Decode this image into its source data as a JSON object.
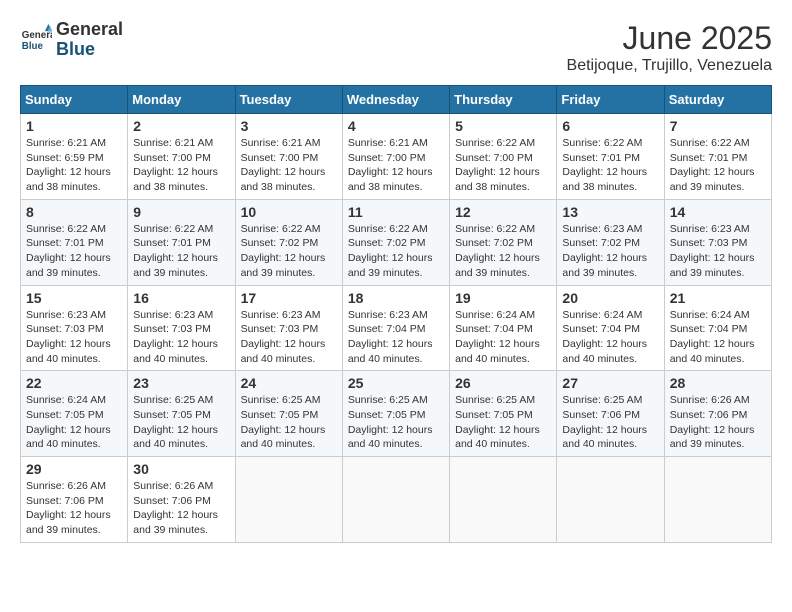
{
  "header": {
    "logo_general": "General",
    "logo_blue": "Blue",
    "title": "June 2025",
    "subtitle": "Betijoque, Trujillo, Venezuela"
  },
  "weekdays": [
    "Sunday",
    "Monday",
    "Tuesday",
    "Wednesday",
    "Thursday",
    "Friday",
    "Saturday"
  ],
  "weeks": [
    [
      {
        "day": "1",
        "info": "Sunrise: 6:21 AM\nSunset: 6:59 PM\nDaylight: 12 hours\nand 38 minutes."
      },
      {
        "day": "2",
        "info": "Sunrise: 6:21 AM\nSunset: 7:00 PM\nDaylight: 12 hours\nand 38 minutes."
      },
      {
        "day": "3",
        "info": "Sunrise: 6:21 AM\nSunset: 7:00 PM\nDaylight: 12 hours\nand 38 minutes."
      },
      {
        "day": "4",
        "info": "Sunrise: 6:21 AM\nSunset: 7:00 PM\nDaylight: 12 hours\nand 38 minutes."
      },
      {
        "day": "5",
        "info": "Sunrise: 6:22 AM\nSunset: 7:00 PM\nDaylight: 12 hours\nand 38 minutes."
      },
      {
        "day": "6",
        "info": "Sunrise: 6:22 AM\nSunset: 7:01 PM\nDaylight: 12 hours\nand 38 minutes."
      },
      {
        "day": "7",
        "info": "Sunrise: 6:22 AM\nSunset: 7:01 PM\nDaylight: 12 hours\nand 39 minutes."
      }
    ],
    [
      {
        "day": "8",
        "info": "Sunrise: 6:22 AM\nSunset: 7:01 PM\nDaylight: 12 hours\nand 39 minutes."
      },
      {
        "day": "9",
        "info": "Sunrise: 6:22 AM\nSunset: 7:01 PM\nDaylight: 12 hours\nand 39 minutes."
      },
      {
        "day": "10",
        "info": "Sunrise: 6:22 AM\nSunset: 7:02 PM\nDaylight: 12 hours\nand 39 minutes."
      },
      {
        "day": "11",
        "info": "Sunrise: 6:22 AM\nSunset: 7:02 PM\nDaylight: 12 hours\nand 39 minutes."
      },
      {
        "day": "12",
        "info": "Sunrise: 6:22 AM\nSunset: 7:02 PM\nDaylight: 12 hours\nand 39 minutes."
      },
      {
        "day": "13",
        "info": "Sunrise: 6:23 AM\nSunset: 7:02 PM\nDaylight: 12 hours\nand 39 minutes."
      },
      {
        "day": "14",
        "info": "Sunrise: 6:23 AM\nSunset: 7:03 PM\nDaylight: 12 hours\nand 39 minutes."
      }
    ],
    [
      {
        "day": "15",
        "info": "Sunrise: 6:23 AM\nSunset: 7:03 PM\nDaylight: 12 hours\nand 40 minutes."
      },
      {
        "day": "16",
        "info": "Sunrise: 6:23 AM\nSunset: 7:03 PM\nDaylight: 12 hours\nand 40 minutes."
      },
      {
        "day": "17",
        "info": "Sunrise: 6:23 AM\nSunset: 7:03 PM\nDaylight: 12 hours\nand 40 minutes."
      },
      {
        "day": "18",
        "info": "Sunrise: 6:23 AM\nSunset: 7:04 PM\nDaylight: 12 hours\nand 40 minutes."
      },
      {
        "day": "19",
        "info": "Sunrise: 6:24 AM\nSunset: 7:04 PM\nDaylight: 12 hours\nand 40 minutes."
      },
      {
        "day": "20",
        "info": "Sunrise: 6:24 AM\nSunset: 7:04 PM\nDaylight: 12 hours\nand 40 minutes."
      },
      {
        "day": "21",
        "info": "Sunrise: 6:24 AM\nSunset: 7:04 PM\nDaylight: 12 hours\nand 40 minutes."
      }
    ],
    [
      {
        "day": "22",
        "info": "Sunrise: 6:24 AM\nSunset: 7:05 PM\nDaylight: 12 hours\nand 40 minutes."
      },
      {
        "day": "23",
        "info": "Sunrise: 6:25 AM\nSunset: 7:05 PM\nDaylight: 12 hours\nand 40 minutes."
      },
      {
        "day": "24",
        "info": "Sunrise: 6:25 AM\nSunset: 7:05 PM\nDaylight: 12 hours\nand 40 minutes."
      },
      {
        "day": "25",
        "info": "Sunrise: 6:25 AM\nSunset: 7:05 PM\nDaylight: 12 hours\nand 40 minutes."
      },
      {
        "day": "26",
        "info": "Sunrise: 6:25 AM\nSunset: 7:05 PM\nDaylight: 12 hours\nand 40 minutes."
      },
      {
        "day": "27",
        "info": "Sunrise: 6:25 AM\nSunset: 7:06 PM\nDaylight: 12 hours\nand 40 minutes."
      },
      {
        "day": "28",
        "info": "Sunrise: 6:26 AM\nSunset: 7:06 PM\nDaylight: 12 hours\nand 39 minutes."
      }
    ],
    [
      {
        "day": "29",
        "info": "Sunrise: 6:26 AM\nSunset: 7:06 PM\nDaylight: 12 hours\nand 39 minutes."
      },
      {
        "day": "30",
        "info": "Sunrise: 6:26 AM\nSunset: 7:06 PM\nDaylight: 12 hours\nand 39 minutes."
      },
      {
        "day": "",
        "info": ""
      },
      {
        "day": "",
        "info": ""
      },
      {
        "day": "",
        "info": ""
      },
      {
        "day": "",
        "info": ""
      },
      {
        "day": "",
        "info": ""
      }
    ]
  ]
}
